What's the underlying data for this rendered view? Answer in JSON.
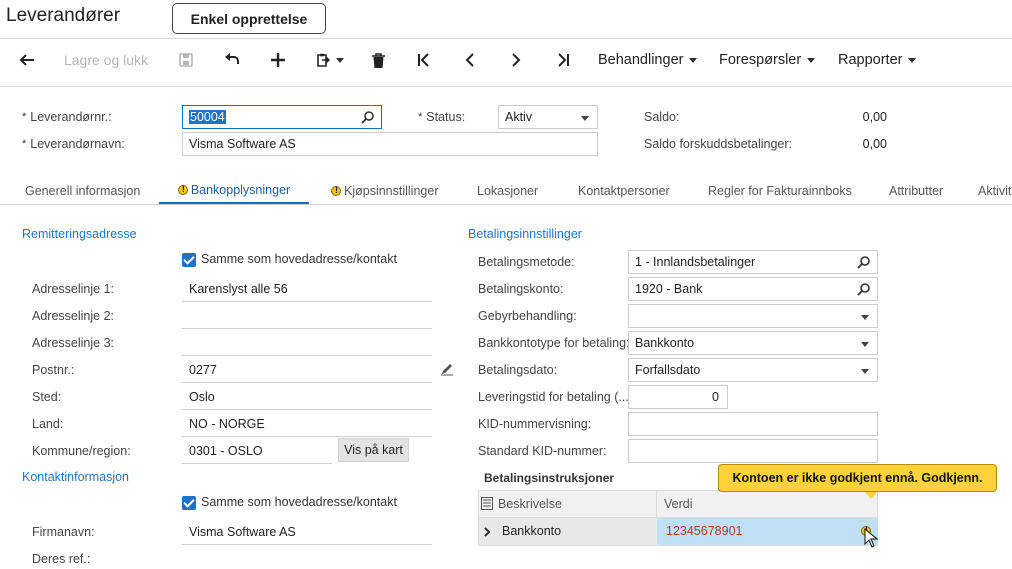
{
  "app": {
    "title": "Leverandører",
    "quick_tab": "Enkel opprettelse"
  },
  "toolbar": {
    "back_icon": "arrow-left-icon",
    "save_close": "Lagre og lukk",
    "save_icon": "floppy-disk-icon",
    "undo_icon": "undo-icon",
    "add_icon": "plus-icon",
    "copy_icon": "copy-paste-icon",
    "delete_icon": "trash-icon",
    "first_icon": "first-record-icon",
    "prev_icon": "prev-record-icon",
    "next_icon": "next-record-icon",
    "last_icon": "last-record-icon",
    "actions": "Behandlinger",
    "inquiries": "Forespørsler",
    "reports": "Rapporter"
  },
  "header": {
    "vendor_no_label": "Leverandørnr.:",
    "vendor_no_value": "50004",
    "vendor_name_label": "Leverandørnavn:",
    "vendor_name_value": "Visma Software AS",
    "status_label": "Status:",
    "status_value": "Aktiv",
    "balance_label": "Saldo:",
    "balance_value": "0,00",
    "prepay_label": "Saldo forskuddsbetalinger:",
    "prepay_value": "0,00"
  },
  "tabs": [
    {
      "label": "Generell informasjon"
    },
    {
      "label": "Bankopplysninger"
    },
    {
      "label": "Kjøpsinnstillinger"
    },
    {
      "label": "Lokasjoner"
    },
    {
      "label": "Kontaktpersoner"
    },
    {
      "label": "Regler for Fakturainnboks"
    },
    {
      "label": "Attributter"
    },
    {
      "label": "Aktivite"
    }
  ],
  "remit": {
    "title": "Remitteringsadresse",
    "same_as_main": "Samme som hovedadresse/kontakt",
    "addr1_label": "Adresselinje 1:",
    "addr1_value": "Karenslyst alle 56",
    "addr2_label": "Adresselinje 2:",
    "addr3_label": "Adresselinje 3:",
    "postal_label": "Postnr.:",
    "postal_value": "0277",
    "city_label": "Sted:",
    "city_value": "Oslo",
    "country_label": "Land:",
    "country_value": "NO - NORGE",
    "county_label": "Kommune/region:",
    "county_value": "0301 - OSLO",
    "map_button": "Vis på kart"
  },
  "contact": {
    "title": "Kontaktinformasjon",
    "same_as_main": "Samme som hovedadresse/kontakt",
    "company_label": "Firmanavn:",
    "company_value": "Visma Software AS",
    "ref_label": "Deres ref.:"
  },
  "payment": {
    "title": "Betalingsinnstillinger",
    "method_label": "Betalingsmetode:",
    "method_value": "1 - Innlandsbetalinger",
    "account_label": "Betalingskonto:",
    "account_value": "1920 - Bank",
    "fee_label": "Gebyrbehandling:",
    "fee_value": "",
    "acctype_label": "Bankkontotype for betaling:",
    "acctype_value": "Bankkonto",
    "date_label": "Betalingsdato:",
    "date_value": "Forfallsdato",
    "leadtime_label": "Leveringstid for betaling (...",
    "leadtime_value": "0",
    "kid_label": "KID-nummervisning:",
    "stdkid_label": "Standard KID-nummer:"
  },
  "instructions": {
    "title": "Betalingsinstruksjoner",
    "col_desc": "Beskrivelse",
    "col_value": "Verdi",
    "row_desc": "Bankkonto",
    "row_value": "12345678901",
    "tooltip": "Kontoen er ikke godkjent ennå. Godkjenn."
  },
  "colors": {
    "accent": "#1e73c8",
    "tooltip_bg": "#ffd23c",
    "row_value_red": "#b03a2e",
    "row_selected": "#bfe0f5"
  }
}
